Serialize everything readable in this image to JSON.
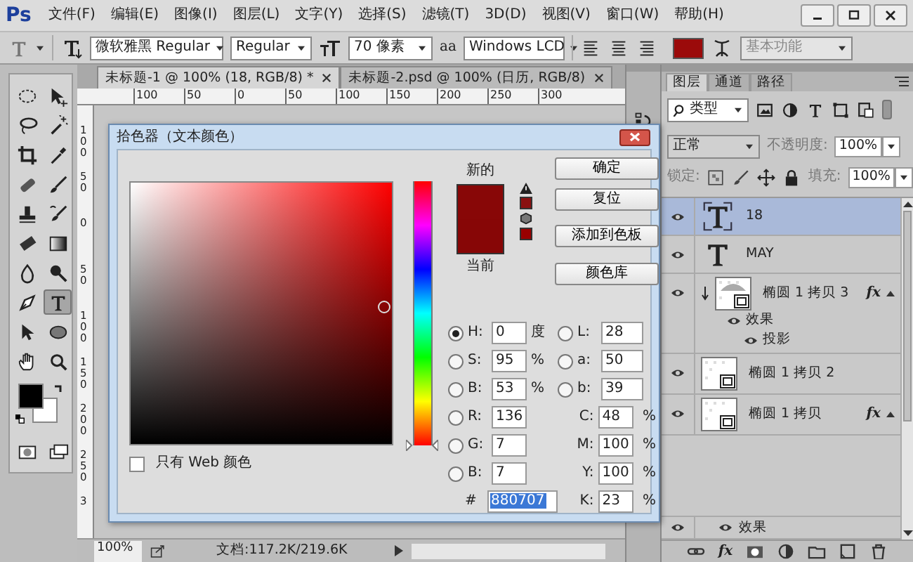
{
  "app": {
    "logo": "Ps"
  },
  "menu_bar": [
    "文件(F)",
    "编辑(E)",
    "图像(I)",
    "图层(L)",
    "文字(Y)",
    "选择(S)",
    "滤镜(T)",
    "3D(D)",
    "视图(V)",
    "窗口(W)",
    "帮助(H)"
  ],
  "options_bar": {
    "font_family": "微软雅黑 Regular",
    "font_style": "Regular",
    "font_size": "70 像素",
    "antialias_label": "aa",
    "antialias": "Windows LCD",
    "workspace": "基本功能"
  },
  "tools": [
    {
      "kind": "marquee",
      "selected": false
    },
    {
      "kind": "move",
      "selected": false
    },
    {
      "kind": "lasso",
      "selected": false
    },
    {
      "kind": "wand",
      "selected": false
    },
    {
      "kind": "crop",
      "selected": false
    },
    {
      "kind": "eyedropper",
      "selected": false
    },
    {
      "kind": "heal",
      "selected": false
    },
    {
      "kind": "brush",
      "selected": false
    },
    {
      "kind": "stamp",
      "selected": false
    },
    {
      "kind": "history",
      "selected": false
    },
    {
      "kind": "eraser",
      "selected": false
    },
    {
      "kind": "gradient",
      "selected": false
    },
    {
      "kind": "blur",
      "selected": false
    },
    {
      "kind": "dodge",
      "selected": false
    },
    {
      "kind": "pen",
      "selected": false
    },
    {
      "kind": "type",
      "selected": true
    },
    {
      "kind": "select",
      "selected": false
    },
    {
      "kind": "shape",
      "selected": false
    },
    {
      "kind": "hand",
      "selected": false
    },
    {
      "kind": "zoom",
      "selected": false
    }
  ],
  "document_tabs": [
    {
      "label": "未标题-1 @ 100% (18, RGB/8) *",
      "selected": true
    },
    {
      "label": "未标题-2.psd @ 100% (日历, RGB/8)",
      "selected": false
    }
  ],
  "ruler": {
    "horizontal": [
      "100",
      "50",
      "0",
      "50",
      "100",
      "150",
      "200",
      "250",
      "300"
    ],
    "vertical": [
      "100",
      "50",
      "0",
      "50",
      "100",
      "150",
      "200",
      "250",
      "3"
    ]
  },
  "status_bar": {
    "zoom": "100%",
    "document_info": "文档:117.2K/219.6K"
  },
  "color_picker": {
    "title": "拾色器（文本颜色）",
    "new_label": "新的",
    "current_label": "当前",
    "hue_slider": {
      "level": 0
    },
    "buttons": [
      "确定",
      "复位",
      "添加到色板",
      "颜色库"
    ],
    "hsb_fields": [
      {
        "label": "H:",
        "value": "0",
        "unit": "度",
        "selected": true
      },
      {
        "label": "S:",
        "value": "95",
        "unit": "%",
        "selected": false
      },
      {
        "label": "B:",
        "value": "53",
        "unit": "%",
        "selected": false
      }
    ],
    "lab_fields": [
      {
        "label": "L:",
        "value": "28",
        "selected": false
      },
      {
        "label": "a:",
        "value": "50",
        "selected": false
      },
      {
        "label": "b:",
        "value": "39",
        "selected": false
      }
    ],
    "rgb_fields": [
      {
        "label": "R:",
        "value": "136",
        "selected": false
      },
      {
        "label": "G:",
        "value": "7",
        "selected": false
      },
      {
        "label": "B:",
        "value": "7",
        "selected": false
      }
    ],
    "cmyk_fields": [
      {
        "label": "C:",
        "value": "48",
        "unit": "%"
      },
      {
        "label": "M:",
        "value": "100",
        "unit": "%"
      },
      {
        "label": "Y:",
        "value": "100",
        "unit": "%"
      },
      {
        "label": "K:",
        "value": "23",
        "unit": "%"
      }
    ],
    "hex": {
      "label": "#",
      "value": "880707",
      "selected": true
    },
    "web_only": {
      "label": "只有 Web 颜色",
      "checked": false
    }
  },
  "layers_panel": {
    "tabs": [
      {
        "label": "图层",
        "selected": true
      },
      {
        "label": "通道",
        "selected": false
      },
      {
        "label": "路径",
        "selected": false
      }
    ],
    "filter": "类型",
    "blend_mode": "正常",
    "opacity_label": "不透明度:",
    "opacity": "100%",
    "lock_label": "锁定:",
    "fill_label": "填充:",
    "fill": "100%",
    "layers": [
      {
        "kind": "text",
        "name": "18",
        "selected": true
      },
      {
        "kind": "text",
        "name": "MAY",
        "selected": false
      },
      {
        "kind": "shape",
        "name": "椭圆 1 拷贝 3",
        "selected": false,
        "clipped": true,
        "badge": "fx",
        "children": [
          {
            "name": "效果",
            "children": [
              {
                "name": "投影"
              }
            ]
          }
        ]
      },
      {
        "kind": "shape",
        "name": "椭圆 1 拷贝 2",
        "selected": false
      },
      {
        "kind": "shape",
        "name": "椭圆 1 拷贝",
        "selected": false,
        "badge": "fx"
      },
      {
        "kind": "effect",
        "name": "效果",
        "selected": false
      }
    ],
    "toolbar_fx": "fx"
  }
}
